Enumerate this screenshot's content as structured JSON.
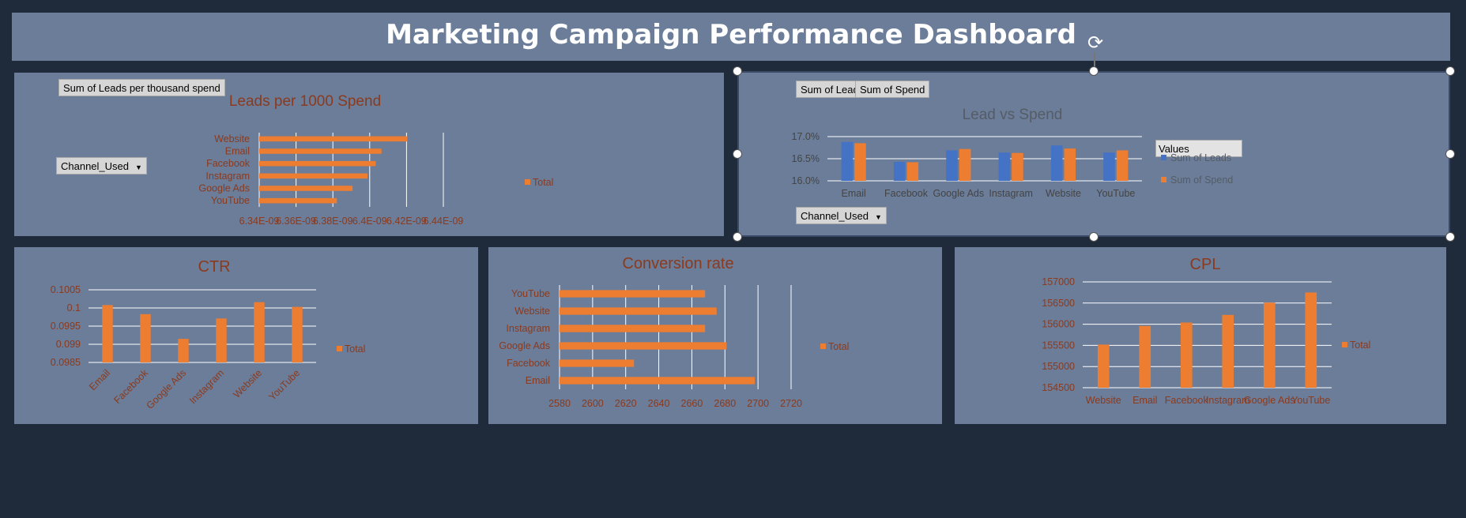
{
  "dashboard": {
    "title": "Marketing Campaign Performance Dashboard"
  },
  "pills": {
    "leads_per_spend_field": "Sum of Leads per thousand  spend",
    "channel_filter_1": "Channel_Used",
    "sum_leads_field": "Sum of Leads",
    "sum_spend_field": "Sum of Spend",
    "channel_filter_2": "Channel_Used",
    "values_box": "Values"
  },
  "colors": {
    "orange": "#ed7d31",
    "blue": "#4472c4",
    "panel": "#6b7d99",
    "title_text": "#8b3a1e",
    "grey_title": "#555c66"
  },
  "chart_data": [
    {
      "id": "leads_per_1000",
      "type": "bar",
      "orientation": "horizontal",
      "title": "Leads per 1000 Spend",
      "categories": [
        "Website",
        "Email",
        "Facebook",
        "Instagram",
        "Google Ads",
        "YouTube"
      ],
      "series": [
        {
          "name": "Total",
          "values": [
            6.4205e-09,
            6.4064e-09,
            6.4033e-09,
            6.3988e-09,
            6.3907e-09,
            6.3822e-09
          ]
        }
      ],
      "xlim": [
        6.34e-09,
        6.44e-09
      ],
      "xticks": [
        "6.34E-09",
        "6.36E-09",
        "6.38E-09",
        "6.4E-09",
        "6.42E-09",
        "6.44E-09"
      ],
      "legend": "right"
    },
    {
      "id": "lead_vs_spend",
      "type": "bar",
      "title": "Lead vs Spend",
      "categories": [
        "Email",
        "Facebook",
        "Google Ads",
        "Instagram",
        "Website",
        "YouTube"
      ],
      "series": [
        {
          "name": "Sum of Leads",
          "values": [
            16.88,
            16.43,
            16.69,
            16.64,
            16.8,
            16.64
          ]
        },
        {
          "name": "Sum of Spend",
          "values": [
            16.85,
            16.42,
            16.72,
            16.63,
            16.73,
            16.69
          ]
        }
      ],
      "ylim": [
        16.0,
        17.0
      ],
      "yticks": [
        "16.0%",
        "16.5%",
        "17.0%"
      ],
      "legend": "right"
    },
    {
      "id": "ctr",
      "type": "bar",
      "title": "CTR",
      "categories": [
        "Email",
        "Facebook",
        "Google Ads",
        "Instagram",
        "Website",
        "YouTube"
      ],
      "series": [
        {
          "name": "Total",
          "values": [
            0.10008,
            0.09983,
            0.09915,
            0.09971,
            0.10016,
            0.10003
          ]
        }
      ],
      "ylim": [
        0.0985,
        0.1005
      ],
      "yticks": [
        "0.0985",
        "0.099",
        "0.0995",
        "0.1",
        "0.1005"
      ],
      "legend": "right"
    },
    {
      "id": "conversion_rate",
      "type": "bar",
      "orientation": "horizontal",
      "title": "Conversion rate",
      "categories": [
        "YouTube",
        "Website",
        "Instagram",
        "Google Ads",
        "Facebook",
        "Email"
      ],
      "series": [
        {
          "name": "Total",
          "values": [
            2668,
            2675,
            2668,
            2681,
            2625,
            2698
          ]
        }
      ],
      "xlim": [
        2580,
        2720
      ],
      "xticks": [
        "2580",
        "2600",
        "2620",
        "2640",
        "2660",
        "2680",
        "2700",
        "2720"
      ],
      "legend": "right"
    },
    {
      "id": "cpl",
      "type": "bar",
      "title": "CPL",
      "categories": [
        "Website",
        "Email",
        "Facebook",
        "Instagram",
        "Google Ads",
        "YouTube"
      ],
      "series": [
        {
          "name": "Total",
          "values": [
            155520,
            155960,
            156040,
            156220,
            156510,
            156750
          ]
        }
      ],
      "ylim": [
        154500,
        157000
      ],
      "yticks": [
        "154500",
        "155000",
        "155500",
        "156000",
        "156500",
        "157000"
      ],
      "legend": "right"
    }
  ]
}
